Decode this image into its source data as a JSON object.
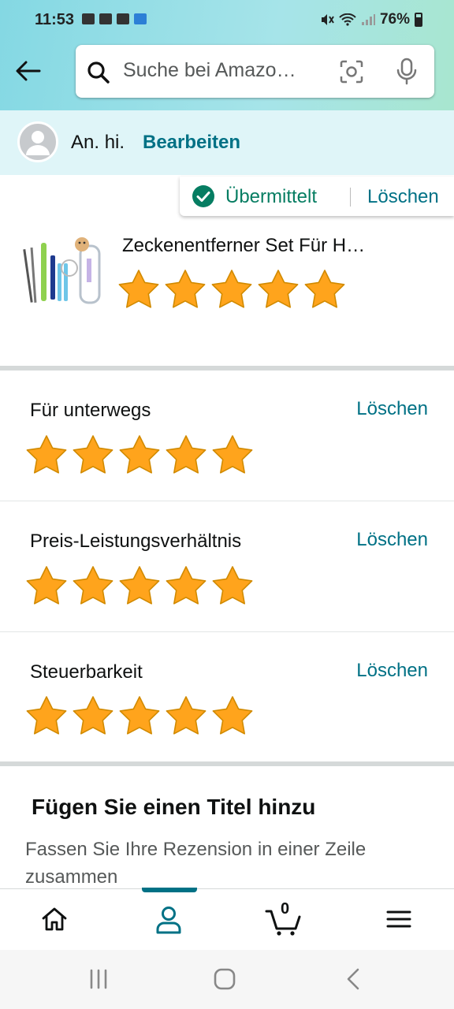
{
  "status_bar": {
    "time": "11:53",
    "battery": "76%"
  },
  "search": {
    "placeholder": "Suche bei Amazo…"
  },
  "icons": {
    "back": "arrow-left-icon",
    "search": "search-icon",
    "camera": "camera-scan-icon",
    "mic": "microphone-icon",
    "check": "check-circle-icon",
    "home": "home-icon",
    "account": "account-icon",
    "cart": "cart-icon",
    "menu": "hamburger-menu-icon"
  },
  "profile": {
    "name": "An. hi.",
    "edit_label": "Bearbeiten"
  },
  "submission": {
    "status_label": "Übermittelt",
    "delete_label": "Löschen"
  },
  "product": {
    "title": "Zeckenentferner Set Für H…",
    "rating": 5,
    "max_rating": 5
  },
  "attributes": [
    {
      "label": "Für unterwegs",
      "delete_label": "Löschen",
      "rating": 5
    },
    {
      "label": "Preis-Leistungsverhältnis",
      "delete_label": "Löschen",
      "rating": 5
    },
    {
      "label": "Steuerbarkeit",
      "delete_label": "Löschen",
      "rating": 5
    }
  ],
  "title_section": {
    "heading": "Fügen Sie einen Titel hinzu",
    "hint": "Fassen Sie Ihre Rezension in einer Zeile zusammen"
  },
  "bottom_nav": {
    "cart_count": "0",
    "active_tab": "account"
  },
  "colors": {
    "accent": "#007185",
    "success": "#067d62",
    "star": "#ffa41c"
  }
}
